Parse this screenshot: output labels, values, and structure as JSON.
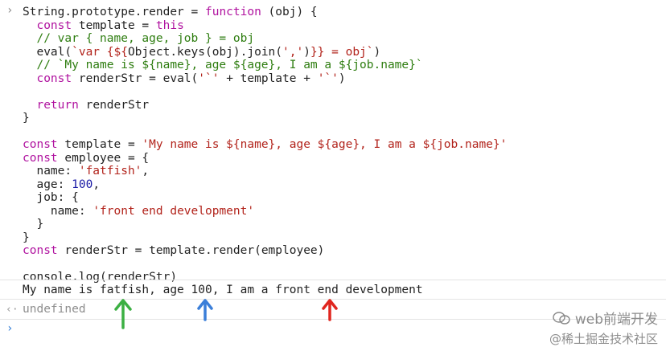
{
  "console": {
    "prompt_symbol": "›",
    "code_lines": [
      {
        "segments": [
          {
            "text": "String.prototype.render = ",
            "cls": ""
          },
          {
            "text": "function",
            "cls": "kw"
          },
          {
            "text": " (obj) {",
            "cls": ""
          }
        ]
      },
      {
        "segments": [
          {
            "text": "  ",
            "cls": ""
          },
          {
            "text": "const",
            "cls": "kw"
          },
          {
            "text": " template = ",
            "cls": ""
          },
          {
            "text": "this",
            "cls": "kw"
          }
        ]
      },
      {
        "segments": [
          {
            "text": "  // var { name, age, job } = obj",
            "cls": "cm"
          }
        ]
      },
      {
        "segments": [
          {
            "text": "  eval(",
            "cls": ""
          },
          {
            "text": "`var {${",
            "cls": "str"
          },
          {
            "text": "Object.keys(obj).join(",
            "cls": ""
          },
          {
            "text": "','",
            "cls": "str"
          },
          {
            "text": ")",
            "cls": ""
          },
          {
            "text": "}} = obj`",
            "cls": "str"
          },
          {
            "text": ")",
            "cls": ""
          }
        ]
      },
      {
        "segments": [
          {
            "text": "  // `My name is ${name}, age ${age}, I am a ${job.name}`",
            "cls": "cm"
          }
        ]
      },
      {
        "segments": [
          {
            "text": "  ",
            "cls": ""
          },
          {
            "text": "const",
            "cls": "kw"
          },
          {
            "text": " renderStr = eval(",
            "cls": ""
          },
          {
            "text": "'`'",
            "cls": "str"
          },
          {
            "text": " + template + ",
            "cls": ""
          },
          {
            "text": "'`'",
            "cls": "str"
          },
          {
            "text": ")",
            "cls": ""
          }
        ]
      },
      {
        "segments": [
          {
            "text": "",
            "cls": ""
          }
        ]
      },
      {
        "segments": [
          {
            "text": "  ",
            "cls": ""
          },
          {
            "text": "return",
            "cls": "kw"
          },
          {
            "text": " renderStr",
            "cls": ""
          }
        ]
      },
      {
        "segments": [
          {
            "text": "}",
            "cls": ""
          }
        ]
      },
      {
        "segments": [
          {
            "text": "",
            "cls": ""
          }
        ]
      },
      {
        "segments": [
          {
            "text": "const",
            "cls": "kw"
          },
          {
            "text": " template = ",
            "cls": ""
          },
          {
            "text": "'My name is ${name}, age ${age}, I am a ${job.name}'",
            "cls": "str"
          }
        ]
      },
      {
        "segments": [
          {
            "text": "const",
            "cls": "kw"
          },
          {
            "text": " employee = {",
            "cls": ""
          }
        ]
      },
      {
        "segments": [
          {
            "text": "  name: ",
            "cls": ""
          },
          {
            "text": "'fatfish'",
            "cls": "str"
          },
          {
            "text": ",",
            "cls": ""
          }
        ]
      },
      {
        "segments": [
          {
            "text": "  age: ",
            "cls": ""
          },
          {
            "text": "100",
            "cls": "num"
          },
          {
            "text": ",",
            "cls": ""
          }
        ]
      },
      {
        "segments": [
          {
            "text": "  job: {",
            "cls": ""
          }
        ]
      },
      {
        "segments": [
          {
            "text": "    name: ",
            "cls": ""
          },
          {
            "text": "'front end development'",
            "cls": "str"
          }
        ]
      },
      {
        "segments": [
          {
            "text": "  }",
            "cls": ""
          }
        ]
      },
      {
        "segments": [
          {
            "text": "}",
            "cls": ""
          }
        ]
      },
      {
        "segments": [
          {
            "text": "const",
            "cls": "kw"
          },
          {
            "text": " renderStr = template.render(employee)",
            "cls": ""
          }
        ]
      },
      {
        "segments": [
          {
            "text": "",
            "cls": ""
          }
        ]
      },
      {
        "segments": [
          {
            "text": "console.log(renderStr)",
            "cls": ""
          }
        ]
      }
    ],
    "output_text": "My name is fatfish, age 100, I am a front end development",
    "return_symbol": "‹·",
    "return_value": "undefined",
    "input_symbol": "›"
  },
  "annotations": {
    "arrow_colors": [
      "#3cb043",
      "#3b7fd9",
      "#e0261f"
    ]
  },
  "watermark": {
    "line1": "web前端开发",
    "line2": "@稀土掘金技术社区",
    "icon": "wechat-icon"
  }
}
